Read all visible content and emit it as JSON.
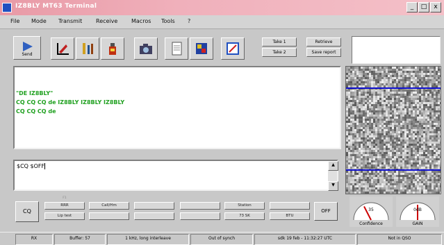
{
  "window": {
    "title": "IZ8BLY MT63 Terminal",
    "min_label": "_",
    "max_label": "□",
    "close_label": "x"
  },
  "menu": [
    "File",
    "Mode",
    "Transmit",
    "Receive",
    "Macros",
    "Tools",
    "?"
  ],
  "toolbar": {
    "send_label": "Send",
    "small_buttons": [
      "Take 1",
      "Take 2",
      "Retrieve",
      "Save report"
    ]
  },
  "rx": {
    "lines": [
      "\"DE IZ8BLY\"",
      "CQ CQ CQ de IZ8BLY IZ8BLY IZ8BLY",
      "CQ CQ CQ de"
    ]
  },
  "tx": {
    "text": "$CQ $OFF",
    "scroll_up": "▲",
    "scroll_down": "▼"
  },
  "macros": {
    "cq_label": "CQ",
    "off_label": "OFF",
    "row1": [
      "RRR",
      "Call/Hm",
      "",
      "",
      "Station",
      ""
    ],
    "row2": [
      "Lip test",
      "",
      "",
      "",
      "73 SK",
      "BTU"
    ]
  },
  "gauges": [
    {
      "label": "Confidence",
      "value": "35",
      "color": "#cc0000",
      "level": 0.35
    },
    {
      "label": "GAIN",
      "value": "0dB",
      "color": "#cc0000",
      "level": 0.5
    }
  ],
  "status": {
    "mode": "RX",
    "buffer": "Buffer: 57",
    "bandwidth": "1 kHz, long interleave",
    "sync": "Out of synch",
    "datetime": "sdk 19 feb - 11:32:27 UTC",
    "qso": "Not in QSO"
  },
  "colors": {
    "rx_text": "#1fa01f",
    "waterfall_line": "#1010d0",
    "titlebar": "#e89aa6"
  },
  "icons": [
    "send-icon",
    "arrow-tool-icon",
    "tools-icon",
    "bottle-icon",
    "camera-icon",
    "document-icon",
    "palette-icon",
    "notepad-icon"
  ]
}
